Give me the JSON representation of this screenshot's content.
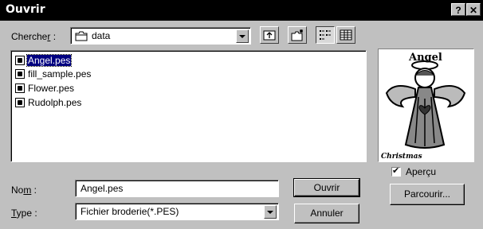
{
  "window": {
    "title": "Ouvrir",
    "help_label": "?",
    "close_label": "✕"
  },
  "lookin": {
    "label_pre": "Cherche",
    "label_key": "r",
    "label_post": " :",
    "value": "data"
  },
  "files": [
    {
      "name": "Angel.pes",
      "selected": true
    },
    {
      "name": "fill_sample.pes",
      "selected": false
    },
    {
      "name": "Flower.pes",
      "selected": false
    },
    {
      "name": "Rudolph.pes",
      "selected": false
    }
  ],
  "filename": {
    "label_pre": "No",
    "label_key": "m",
    "label_post": " :",
    "value": "Angel.pes"
  },
  "filetype": {
    "label_key": "T",
    "label_post": "ype :",
    "value": "Fichier broderie(*.PES)"
  },
  "buttons": {
    "open": "Ouvrir",
    "cancel": "Annuler",
    "browse": "Parcourir..."
  },
  "preview": {
    "checkbox_label": "Aperçu",
    "checked": true,
    "top_text": "Angel",
    "bottom_text": "Christmas"
  },
  "colors": {
    "titlebar": "#000000",
    "selection": "#000080",
    "face": "#c0c0c0"
  }
}
